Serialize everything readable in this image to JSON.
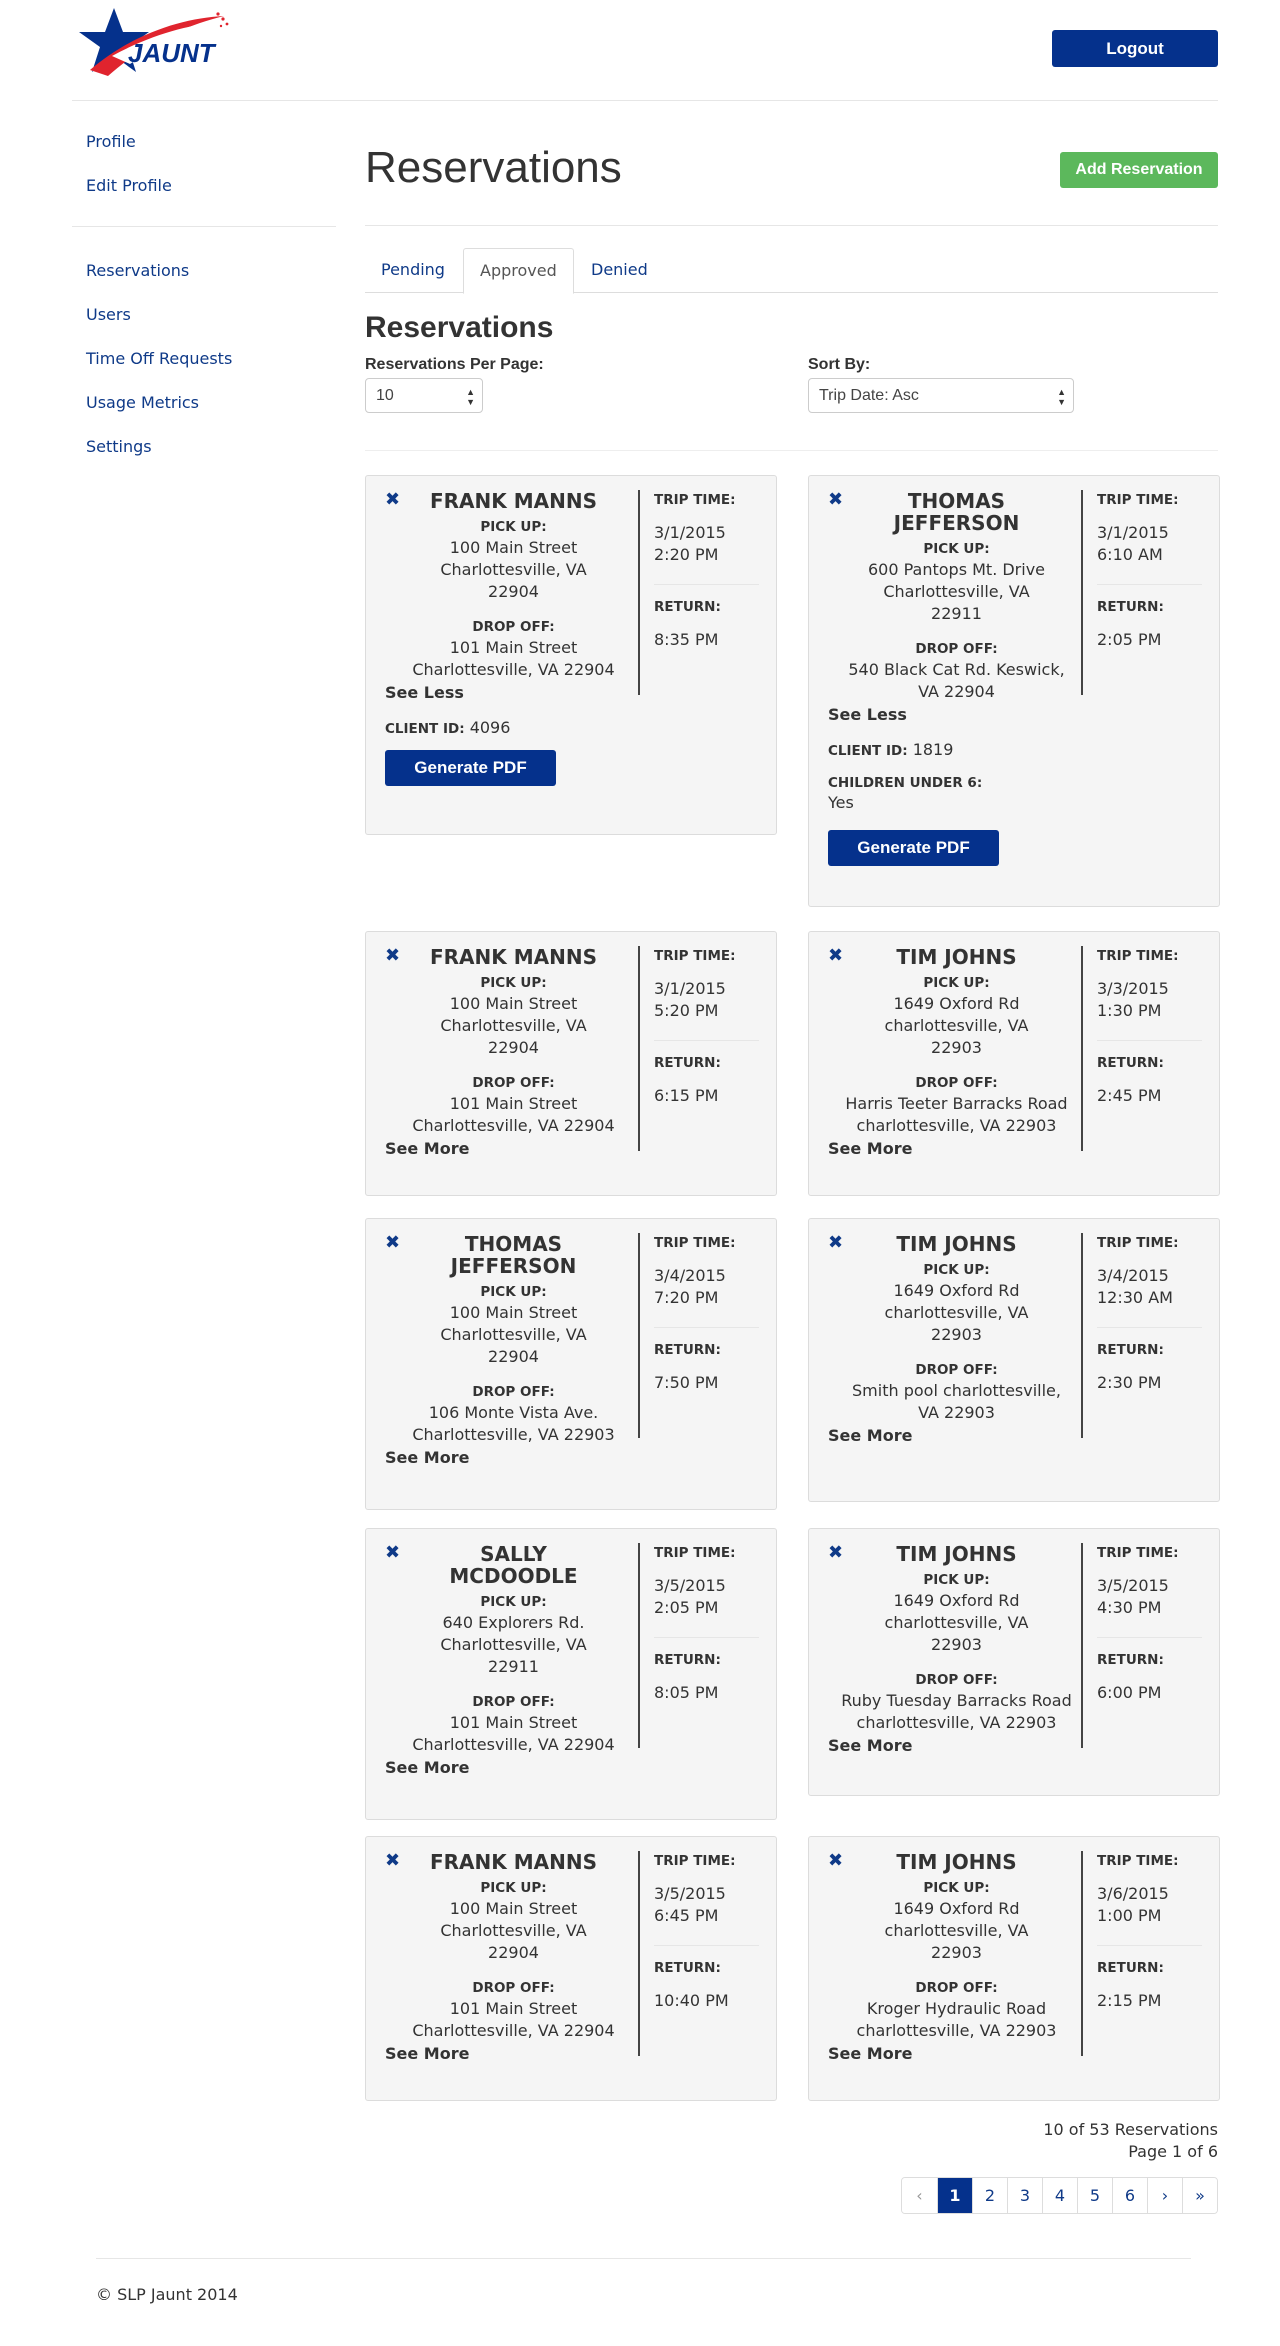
{
  "header": {
    "logo_text": "JAUNT",
    "logout_label": "Logout"
  },
  "sidebar": {
    "profile_items": [
      {
        "label": "Profile"
      },
      {
        "label": "Edit Profile"
      }
    ],
    "admin_items": [
      {
        "label": "Reservations"
      },
      {
        "label": "Users"
      },
      {
        "label": "Time Off Requests"
      },
      {
        "label": "Usage Metrics"
      },
      {
        "label": "Settings"
      }
    ]
  },
  "main": {
    "title": "Reservations",
    "add_label": "Add Reservation",
    "tabs": [
      {
        "label": "Pending",
        "active": false
      },
      {
        "label": "Approved",
        "active": true
      },
      {
        "label": "Denied",
        "active": false
      }
    ],
    "section_title": "Reservations",
    "per_page_label": "Reservations Per Page:",
    "per_page_value": "10",
    "sort_label": "Sort By:",
    "sort_value": "Trip Date: Asc"
  },
  "labels": {
    "pick_up": "PICK UP:",
    "drop_off": "DROP OFF:",
    "trip_time": "TRIP TIME:",
    "return": "RETURN:",
    "client_id": "CLIENT ID:",
    "children_under_6": "CHILDREN UNDER 6:",
    "generate_pdf": "Generate PDF",
    "close_glyph": "✖"
  },
  "reservations": [
    {
      "name_lines": [
        "FRANK MANNS"
      ],
      "pickup": [
        "100 Main Street",
        "Charlottesville, VA",
        "22904"
      ],
      "dropoff": [
        "101 Main Street",
        "Charlottesville, VA 22904"
      ],
      "trip_date": "3/1/2015",
      "trip_time": "2:20 PM",
      "return_time": "8:35 PM",
      "toggle": "See Less",
      "client_id": "4096",
      "children": null
    },
    {
      "name_lines": [
        "THOMAS",
        "JEFFERSON"
      ],
      "pickup": [
        "600 Pantops Mt. Drive",
        "Charlottesville, VA",
        "22911"
      ],
      "dropoff": [
        "540 Black Cat Rd. Keswick,",
        "VA 22904"
      ],
      "trip_date": "3/1/2015",
      "trip_time": "6:10 AM",
      "return_time": "2:05 PM",
      "toggle": "See Less",
      "client_id": "1819",
      "children": "Yes"
    },
    {
      "name_lines": [
        "FRANK MANNS"
      ],
      "pickup": [
        "100 Main Street",
        "Charlottesville, VA",
        "22904"
      ],
      "dropoff": [
        "101 Main Street",
        "Charlottesville, VA 22904"
      ],
      "trip_date": "3/1/2015",
      "trip_time": "5:20 PM",
      "return_time": "6:15 PM",
      "toggle": "See More"
    },
    {
      "name_lines": [
        "TIM JOHNS"
      ],
      "pickup": [
        "1649 Oxford Rd",
        "charlottesville, VA",
        "22903"
      ],
      "dropoff": [
        "Harris Teeter Barracks Road",
        "charlottesville, VA 22903"
      ],
      "trip_date": "3/3/2015",
      "trip_time": "1:30 PM",
      "return_time": "2:45 PM",
      "toggle": "See More"
    },
    {
      "name_lines": [
        "THOMAS",
        "JEFFERSON"
      ],
      "pickup": [
        "100 Main Street",
        "Charlottesville, VA",
        "22904"
      ],
      "dropoff": [
        "106 Monte Vista Ave.",
        "Charlottesville, VA 22903"
      ],
      "trip_date": "3/4/2015",
      "trip_time": "7:20 PM",
      "return_time": "7:50 PM",
      "toggle": "See More"
    },
    {
      "name_lines": [
        "TIM JOHNS"
      ],
      "pickup": [
        "1649 Oxford Rd",
        "charlottesville, VA",
        "22903"
      ],
      "dropoff": [
        "Smith pool charlottesville,",
        "VA 22903"
      ],
      "trip_date": "3/4/2015",
      "trip_time": "12:30 AM",
      "return_time": "2:30 PM",
      "toggle": "See More"
    },
    {
      "name_lines": [
        "SALLY",
        "MCDOODLE"
      ],
      "pickup": [
        "640 Explorers Rd.",
        "Charlottesville, VA",
        "22911"
      ],
      "dropoff": [
        "101 Main Street",
        "Charlottesville, VA 22904"
      ],
      "trip_date": "3/5/2015",
      "trip_time": "2:05 PM",
      "return_time": "8:05 PM",
      "toggle": "See More"
    },
    {
      "name_lines": [
        "TIM JOHNS"
      ],
      "pickup": [
        "1649 Oxford Rd",
        "charlottesville, VA",
        "22903"
      ],
      "dropoff": [
        "Ruby Tuesday Barracks Road",
        "charlottesville, VA 22903"
      ],
      "trip_date": "3/5/2015",
      "trip_time": "4:30 PM",
      "return_time": "6:00 PM",
      "toggle": "See More"
    },
    {
      "name_lines": [
        "FRANK MANNS"
      ],
      "pickup": [
        "100 Main Street",
        "Charlottesville, VA",
        "22904"
      ],
      "dropoff": [
        "101 Main Street",
        "Charlottesville, VA 22904"
      ],
      "trip_date": "3/5/2015",
      "trip_time": "6:45 PM",
      "return_time": "10:40 PM",
      "toggle": "See More"
    },
    {
      "name_lines": [
        "TIM JOHNS"
      ],
      "pickup": [
        "1649 Oxford Rd",
        "charlottesville, VA",
        "22903"
      ],
      "dropoff": [
        "Kroger Hydraulic Road",
        "charlottesville, VA 22903"
      ],
      "trip_date": "3/6/2015",
      "trip_time": "1:00 PM",
      "return_time": "2:15 PM",
      "toggle": "See More"
    }
  ],
  "pagination": {
    "count_text": "10 of 53 Reservations",
    "page_text": "Page 1 of 6",
    "pages": [
      "‹",
      "1",
      "2",
      "3",
      "4",
      "5",
      "6",
      "›",
      "»"
    ],
    "current": "1"
  },
  "footer": {
    "text": "© SLP Jaunt 2014"
  },
  "colors": {
    "brand_blue": "#05318c",
    "link_blue": "#0f3a88",
    "success_green": "#5cb85c",
    "logo_red": "#e0242e"
  }
}
